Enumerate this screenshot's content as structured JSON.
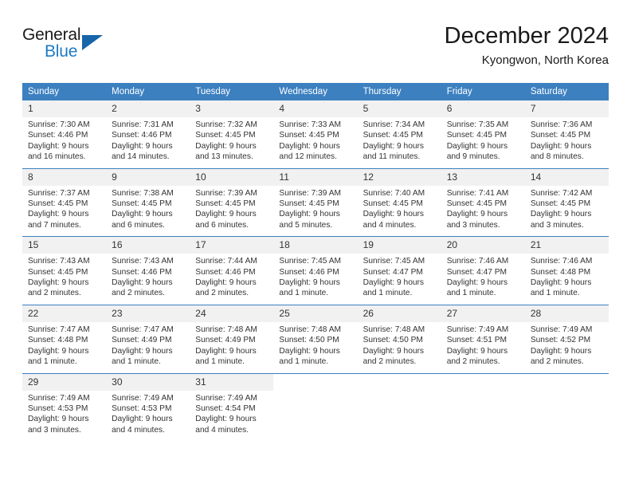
{
  "brand": {
    "word_one": "General",
    "word_two": "Blue",
    "logo_icon": "triangle-icon",
    "accent_color": "#1d7ac4"
  },
  "header": {
    "title": "December 2024",
    "subtitle": "Kyongwon, North Korea"
  },
  "calendar": {
    "header_color": "#3c80c0",
    "weekday_headers": [
      "Sunday",
      "Monday",
      "Tuesday",
      "Wednesday",
      "Thursday",
      "Friday",
      "Saturday"
    ],
    "weeks": [
      [
        {
          "day": "1",
          "sunrise": "Sunrise: 7:30 AM",
          "sunset": "Sunset: 4:46 PM",
          "daylight_1": "Daylight: 9 hours",
          "daylight_2": "and 16 minutes."
        },
        {
          "day": "2",
          "sunrise": "Sunrise: 7:31 AM",
          "sunset": "Sunset: 4:46 PM",
          "daylight_1": "Daylight: 9 hours",
          "daylight_2": "and 14 minutes."
        },
        {
          "day": "3",
          "sunrise": "Sunrise: 7:32 AM",
          "sunset": "Sunset: 4:45 PM",
          "daylight_1": "Daylight: 9 hours",
          "daylight_2": "and 13 minutes."
        },
        {
          "day": "4",
          "sunrise": "Sunrise: 7:33 AM",
          "sunset": "Sunset: 4:45 PM",
          "daylight_1": "Daylight: 9 hours",
          "daylight_2": "and 12 minutes."
        },
        {
          "day": "5",
          "sunrise": "Sunrise: 7:34 AM",
          "sunset": "Sunset: 4:45 PM",
          "daylight_1": "Daylight: 9 hours",
          "daylight_2": "and 11 minutes."
        },
        {
          "day": "6",
          "sunrise": "Sunrise: 7:35 AM",
          "sunset": "Sunset: 4:45 PM",
          "daylight_1": "Daylight: 9 hours",
          "daylight_2": "and 9 minutes."
        },
        {
          "day": "7",
          "sunrise": "Sunrise: 7:36 AM",
          "sunset": "Sunset: 4:45 PM",
          "daylight_1": "Daylight: 9 hours",
          "daylight_2": "and 8 minutes."
        }
      ],
      [
        {
          "day": "8",
          "sunrise": "Sunrise: 7:37 AM",
          "sunset": "Sunset: 4:45 PM",
          "daylight_1": "Daylight: 9 hours",
          "daylight_2": "and 7 minutes."
        },
        {
          "day": "9",
          "sunrise": "Sunrise: 7:38 AM",
          "sunset": "Sunset: 4:45 PM",
          "daylight_1": "Daylight: 9 hours",
          "daylight_2": "and 6 minutes."
        },
        {
          "day": "10",
          "sunrise": "Sunrise: 7:39 AM",
          "sunset": "Sunset: 4:45 PM",
          "daylight_1": "Daylight: 9 hours",
          "daylight_2": "and 6 minutes."
        },
        {
          "day": "11",
          "sunrise": "Sunrise: 7:39 AM",
          "sunset": "Sunset: 4:45 PM",
          "daylight_1": "Daylight: 9 hours",
          "daylight_2": "and 5 minutes."
        },
        {
          "day": "12",
          "sunrise": "Sunrise: 7:40 AM",
          "sunset": "Sunset: 4:45 PM",
          "daylight_1": "Daylight: 9 hours",
          "daylight_2": "and 4 minutes."
        },
        {
          "day": "13",
          "sunrise": "Sunrise: 7:41 AM",
          "sunset": "Sunset: 4:45 PM",
          "daylight_1": "Daylight: 9 hours",
          "daylight_2": "and 3 minutes."
        },
        {
          "day": "14",
          "sunrise": "Sunrise: 7:42 AM",
          "sunset": "Sunset: 4:45 PM",
          "daylight_1": "Daylight: 9 hours",
          "daylight_2": "and 3 minutes."
        }
      ],
      [
        {
          "day": "15",
          "sunrise": "Sunrise: 7:43 AM",
          "sunset": "Sunset: 4:45 PM",
          "daylight_1": "Daylight: 9 hours",
          "daylight_2": "and 2 minutes."
        },
        {
          "day": "16",
          "sunrise": "Sunrise: 7:43 AM",
          "sunset": "Sunset: 4:46 PM",
          "daylight_1": "Daylight: 9 hours",
          "daylight_2": "and 2 minutes."
        },
        {
          "day": "17",
          "sunrise": "Sunrise: 7:44 AM",
          "sunset": "Sunset: 4:46 PM",
          "daylight_1": "Daylight: 9 hours",
          "daylight_2": "and 2 minutes."
        },
        {
          "day": "18",
          "sunrise": "Sunrise: 7:45 AM",
          "sunset": "Sunset: 4:46 PM",
          "daylight_1": "Daylight: 9 hours",
          "daylight_2": "and 1 minute."
        },
        {
          "day": "19",
          "sunrise": "Sunrise: 7:45 AM",
          "sunset": "Sunset: 4:47 PM",
          "daylight_1": "Daylight: 9 hours",
          "daylight_2": "and 1 minute."
        },
        {
          "day": "20",
          "sunrise": "Sunrise: 7:46 AM",
          "sunset": "Sunset: 4:47 PM",
          "daylight_1": "Daylight: 9 hours",
          "daylight_2": "and 1 minute."
        },
        {
          "day": "21",
          "sunrise": "Sunrise: 7:46 AM",
          "sunset": "Sunset: 4:48 PM",
          "daylight_1": "Daylight: 9 hours",
          "daylight_2": "and 1 minute."
        }
      ],
      [
        {
          "day": "22",
          "sunrise": "Sunrise: 7:47 AM",
          "sunset": "Sunset: 4:48 PM",
          "daylight_1": "Daylight: 9 hours",
          "daylight_2": "and 1 minute."
        },
        {
          "day": "23",
          "sunrise": "Sunrise: 7:47 AM",
          "sunset": "Sunset: 4:49 PM",
          "daylight_1": "Daylight: 9 hours",
          "daylight_2": "and 1 minute."
        },
        {
          "day": "24",
          "sunrise": "Sunrise: 7:48 AM",
          "sunset": "Sunset: 4:49 PM",
          "daylight_1": "Daylight: 9 hours",
          "daylight_2": "and 1 minute."
        },
        {
          "day": "25",
          "sunrise": "Sunrise: 7:48 AM",
          "sunset": "Sunset: 4:50 PM",
          "daylight_1": "Daylight: 9 hours",
          "daylight_2": "and 1 minute."
        },
        {
          "day": "26",
          "sunrise": "Sunrise: 7:48 AM",
          "sunset": "Sunset: 4:50 PM",
          "daylight_1": "Daylight: 9 hours",
          "daylight_2": "and 2 minutes."
        },
        {
          "day": "27",
          "sunrise": "Sunrise: 7:49 AM",
          "sunset": "Sunset: 4:51 PM",
          "daylight_1": "Daylight: 9 hours",
          "daylight_2": "and 2 minutes."
        },
        {
          "day": "28",
          "sunrise": "Sunrise: 7:49 AM",
          "sunset": "Sunset: 4:52 PM",
          "daylight_1": "Daylight: 9 hours",
          "daylight_2": "and 2 minutes."
        }
      ],
      [
        {
          "day": "29",
          "sunrise": "Sunrise: 7:49 AM",
          "sunset": "Sunset: 4:53 PM",
          "daylight_1": "Daylight: 9 hours",
          "daylight_2": "and 3 minutes."
        },
        {
          "day": "30",
          "sunrise": "Sunrise: 7:49 AM",
          "sunset": "Sunset: 4:53 PM",
          "daylight_1": "Daylight: 9 hours",
          "daylight_2": "and 4 minutes."
        },
        {
          "day": "31",
          "sunrise": "Sunrise: 7:49 AM",
          "sunset": "Sunset: 4:54 PM",
          "daylight_1": "Daylight: 9 hours",
          "daylight_2": "and 4 minutes."
        },
        {
          "day": "",
          "sunrise": "",
          "sunset": "",
          "daylight_1": "",
          "daylight_2": ""
        },
        {
          "day": "",
          "sunrise": "",
          "sunset": "",
          "daylight_1": "",
          "daylight_2": ""
        },
        {
          "day": "",
          "sunrise": "",
          "sunset": "",
          "daylight_1": "",
          "daylight_2": ""
        },
        {
          "day": "",
          "sunrise": "",
          "sunset": "",
          "daylight_1": "",
          "daylight_2": ""
        }
      ]
    ]
  }
}
